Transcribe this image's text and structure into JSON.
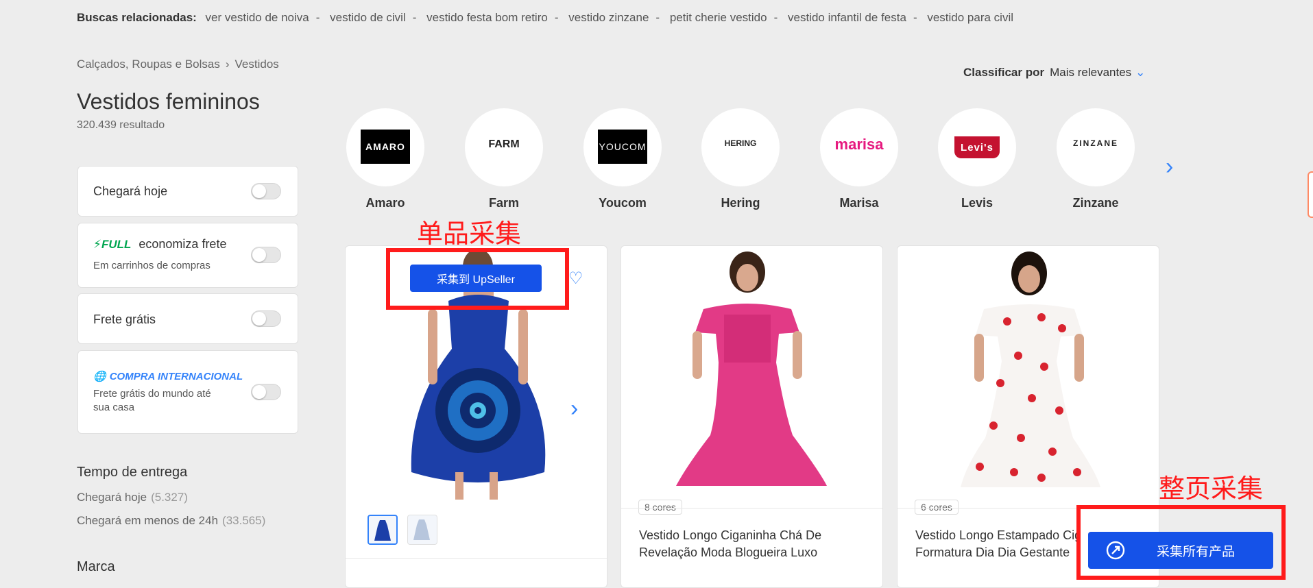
{
  "related": {
    "label": "Buscas relacionadas:",
    "items": [
      "ver vestido de noiva",
      "vestido de civil",
      "vestido festa bom retiro",
      "vestido zinzane",
      "petit cherie vestido",
      "vestido infantil de festa",
      "vestido para civil"
    ],
    "separator": "-"
  },
  "breadcrumb": {
    "parent": "Calçados, Roupas e Bolsas",
    "current": "Vestidos"
  },
  "page": {
    "title": "Vestidos femininos",
    "results": "320.439 resultado"
  },
  "filters": {
    "arrives_today": "Chegará hoje",
    "full_tag": "FULL",
    "full_label": "economiza frete",
    "full_sub": "Em carrinhos de compras",
    "free_shipping": "Frete grátis",
    "intl_tag": "COMPRA INTERNACIONAL",
    "intl_sub": "Frete grátis do mundo até sua casa"
  },
  "delivery": {
    "heading": "Tempo de entrega",
    "items": [
      {
        "label": "Chegará hoje",
        "count": "(5.327)"
      },
      {
        "label": "Chegará em menos de 24h",
        "count": "(33.565)"
      }
    ]
  },
  "brand_filter": {
    "heading": "Marca"
  },
  "sort": {
    "label": "Classificar por",
    "value": "Mais relevantes"
  },
  "brands": [
    {
      "name": "Amaro",
      "logo": "AMARO"
    },
    {
      "name": "Farm",
      "logo": "FARM"
    },
    {
      "name": "Youcom",
      "logo": "YOUCOM"
    },
    {
      "name": "Hering",
      "logo": "HERING"
    },
    {
      "name": "Marisa",
      "logo": "marisa"
    },
    {
      "name": "Levis",
      "logo": "Levi's"
    },
    {
      "name": "Zinzane",
      "logo": "ZINZANE"
    }
  ],
  "products": [
    {
      "title": "",
      "colors": ""
    },
    {
      "title": "Vestido Longo Ciganinha Chá De Revelação Moda Blogueira Luxo",
      "colors": "8 cores"
    },
    {
      "title": "Vestido Longo Estampado Cig Formatura Dia Dia Gestante",
      "colors": "6 cores"
    }
  ],
  "overlay": {
    "single_label": "单品采集",
    "single_button": "采集到 UpSeller",
    "page_label": "整页采集",
    "page_button": "采集所有产品"
  },
  "colors": {
    "accent": "#3483fa",
    "upseller_blue": "#1552e8",
    "annotation_red": "#ff1b1b",
    "full_green": "#00a650"
  }
}
